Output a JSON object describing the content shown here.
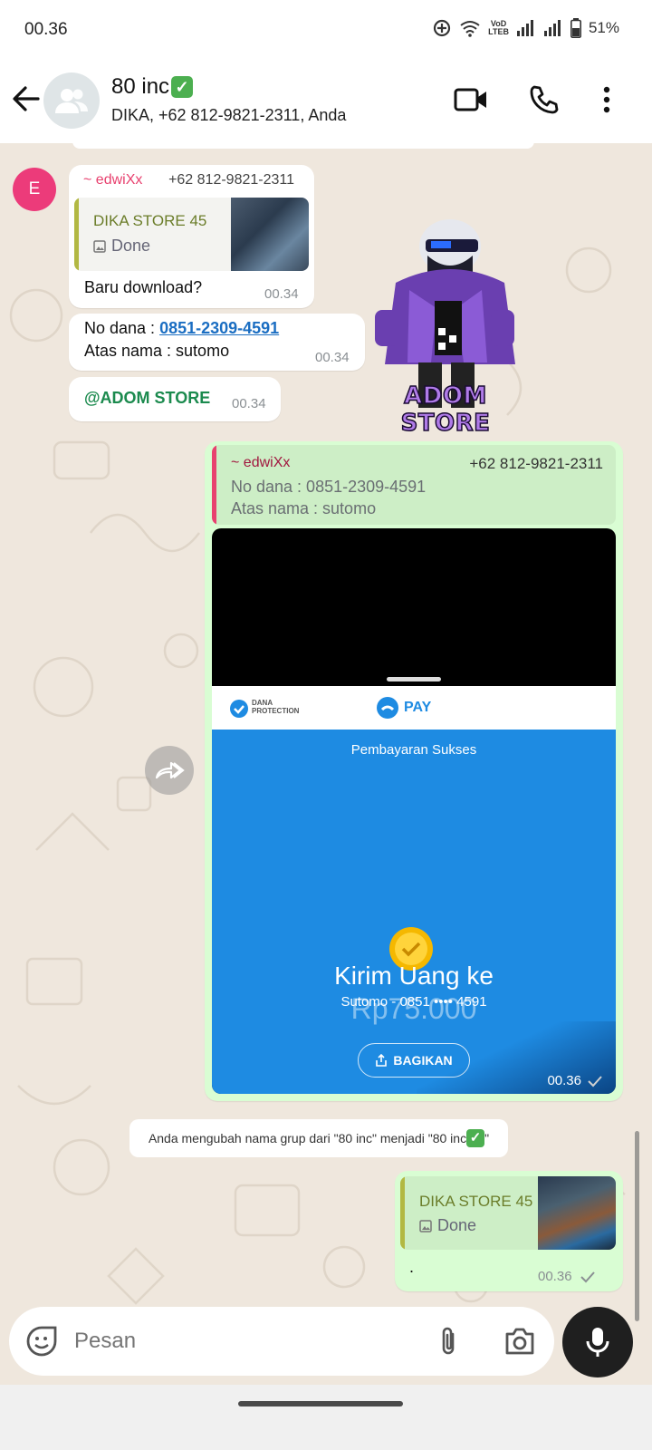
{
  "status_bar": {
    "time": "00.36",
    "battery": "51%",
    "volte_line1": "VoD",
    "volte_line2": "LTEB"
  },
  "header": {
    "title": "80 inc",
    "title_emoji": "✓",
    "subtitle": "DIKA, +62 812-9821-2311, Anda"
  },
  "messages": {
    "m1": {
      "avatar_letter": "E",
      "sender": "~ edwiXx",
      "phone": "+62 812-9821-2311",
      "quote_title": "DIKA STORE 45",
      "quote_sub": "Done",
      "text": "Baru download?",
      "time": "00.34"
    },
    "m2": {
      "line1_prefix": "No dana : ",
      "line1_link": "0851-2309-4591",
      "line2": "Atas nama : sutomo",
      "time": "00.34"
    },
    "m3": {
      "text": "@ADOM STORE",
      "time": "00.34"
    },
    "sticker": {
      "label": "ADOM STORE"
    },
    "m4": {
      "quote_sender": "~ edwiXx",
      "quote_phone": "+62 812-9821-2311",
      "quote_line1": "No dana : 0851-2309-4591",
      "quote_line2": "Atas nama : sutomo",
      "time": "00.36",
      "screenshot": {
        "dana_protection_1": "DANA",
        "dana_protection_2": "PROTECTION",
        "pay": "PAY",
        "status": "Pembayaran Sukses",
        "headline": "Kirim Uang ke",
        "recipient": "Sutomo - 0851 •••• 4591",
        "amount": "Rp75.000",
        "share_button": "BAGIKAN"
      }
    },
    "system": {
      "text_prefix": "Anda mengubah nama grup dari \"80 inc\" menjadi \"80 inc",
      "text_emoji": "✓",
      "text_suffix": "\""
    },
    "m5": {
      "quote_title": "DIKA STORE 45",
      "quote_sub": "Done",
      "text": ".",
      "time": "00.36"
    }
  },
  "input": {
    "placeholder": "Pesan"
  },
  "colors": {
    "outgoing_bubble": "#d9fdd3",
    "chat_bg": "#efe7dd",
    "dana_blue": "#1e8be2",
    "sender_pink": "#e8416f"
  }
}
